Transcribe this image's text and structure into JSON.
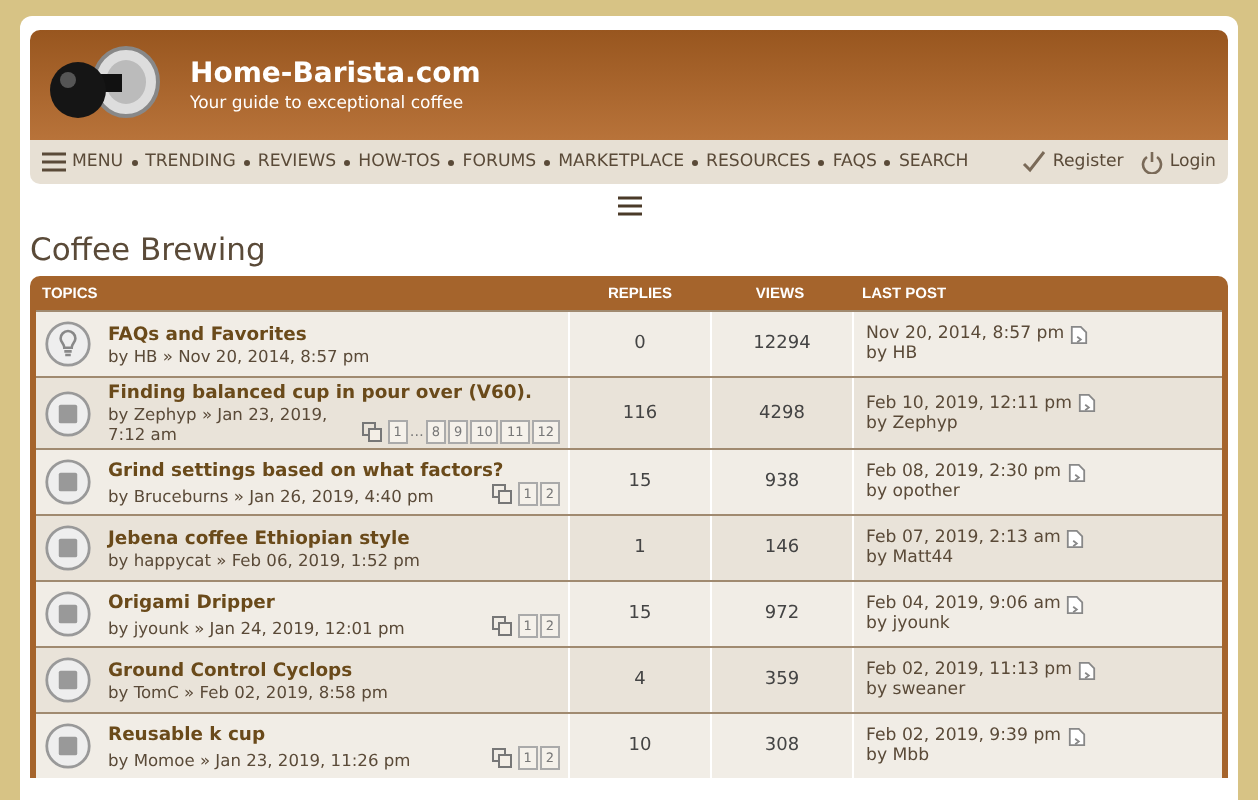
{
  "site": {
    "title": "Home-Barista.com",
    "tagline": "Your guide to exceptional coffee"
  },
  "nav": {
    "items": [
      {
        "label": "MENU",
        "kind": "menu"
      },
      {
        "label": "TRENDING",
        "kind": "link"
      },
      {
        "label": "REVIEWS",
        "kind": "link"
      },
      {
        "label": "HOW-TOS",
        "kind": "link"
      },
      {
        "label": "FORUMS",
        "kind": "link"
      },
      {
        "label": "MARKETPLACE",
        "kind": "link"
      },
      {
        "label": "RESOURCES",
        "kind": "link"
      },
      {
        "label": "FAQS",
        "kind": "link"
      },
      {
        "label": "SEARCH",
        "kind": "link"
      }
    ],
    "account": [
      {
        "label": "Register",
        "kind": "register"
      },
      {
        "label": "Login",
        "kind": "login"
      }
    ]
  },
  "forum": {
    "title": "Coffee Brewing"
  },
  "table": {
    "columns": [
      "TOPICS",
      "REPLIES",
      "VIEWS",
      "LAST POST"
    ],
    "rows": [
      {
        "kind": "sticky",
        "title": "FAQs and Favorites",
        "author": "by HB",
        "date": "» Nov 20, 2014, 8:57 pm",
        "pages": [],
        "replies": "0",
        "views": "12294",
        "last_date": "Nov 20, 2014, 8:57 pm",
        "last_by": "by HB"
      },
      {
        "kind": "topic",
        "title": "Finding balanced cup in pour over (V60).",
        "author": "by Zephyp",
        "date": "» Jan 23, 2019, 7:12 am",
        "pages": [
          {
            "kind": "page",
            "label": "1"
          },
          {
            "kind": "gap",
            "label": "…"
          },
          {
            "kind": "page",
            "label": "8"
          },
          {
            "kind": "page",
            "label": "9"
          },
          {
            "kind": "page",
            "label": "10"
          },
          {
            "kind": "page",
            "label": "11"
          },
          {
            "kind": "page",
            "label": "12"
          }
        ],
        "replies": "116",
        "views": "4298",
        "last_date": "Feb 10, 2019, 12:11 pm",
        "last_by": "by Zephyp"
      },
      {
        "kind": "topic",
        "title": "Grind settings based on what factors?",
        "author": "by Bruceburns",
        "date": "» Jan 26, 2019, 4:40 pm",
        "pages": [
          {
            "kind": "page",
            "label": "1"
          },
          {
            "kind": "page",
            "label": "2"
          }
        ],
        "replies": "15",
        "views": "938",
        "last_date": "Feb 08, 2019, 2:30 pm",
        "last_by": "by opother"
      },
      {
        "kind": "topic",
        "title": "Jebena coffee Ethiopian style",
        "author": "by happycat",
        "date": "» Feb 06, 2019, 1:52 pm",
        "pages": [],
        "replies": "1",
        "views": "146",
        "last_date": "Feb 07, 2019, 2:13 am",
        "last_by": "by Matt44"
      },
      {
        "kind": "topic",
        "title": "Origami Dripper",
        "author": "by jyounk",
        "date": "» Jan 24, 2019, 12:01 pm",
        "pages": [
          {
            "kind": "page",
            "label": "1"
          },
          {
            "kind": "page",
            "label": "2"
          }
        ],
        "replies": "15",
        "views": "972",
        "last_date": "Feb 04, 2019, 9:06 am",
        "last_by": "by jyounk"
      },
      {
        "kind": "topic",
        "title": "Ground Control Cyclops",
        "author": "by TomC",
        "date": "» Feb 02, 2019, 8:58 pm",
        "pages": [],
        "replies": "4",
        "views": "359",
        "last_date": "Feb 02, 2019, 11:13 pm",
        "last_by": "by sweaner"
      },
      {
        "kind": "topic",
        "title": "Reusable k cup",
        "author": "by Momoe",
        "date": "» Jan 23, 2019, 11:26 pm",
        "pages": [
          {
            "kind": "page",
            "label": "1"
          },
          {
            "kind": "page",
            "label": "2"
          }
        ],
        "replies": "10",
        "views": "308",
        "last_date": "Feb 02, 2019, 9:39 pm",
        "last_by": "by Mbb"
      }
    ]
  }
}
